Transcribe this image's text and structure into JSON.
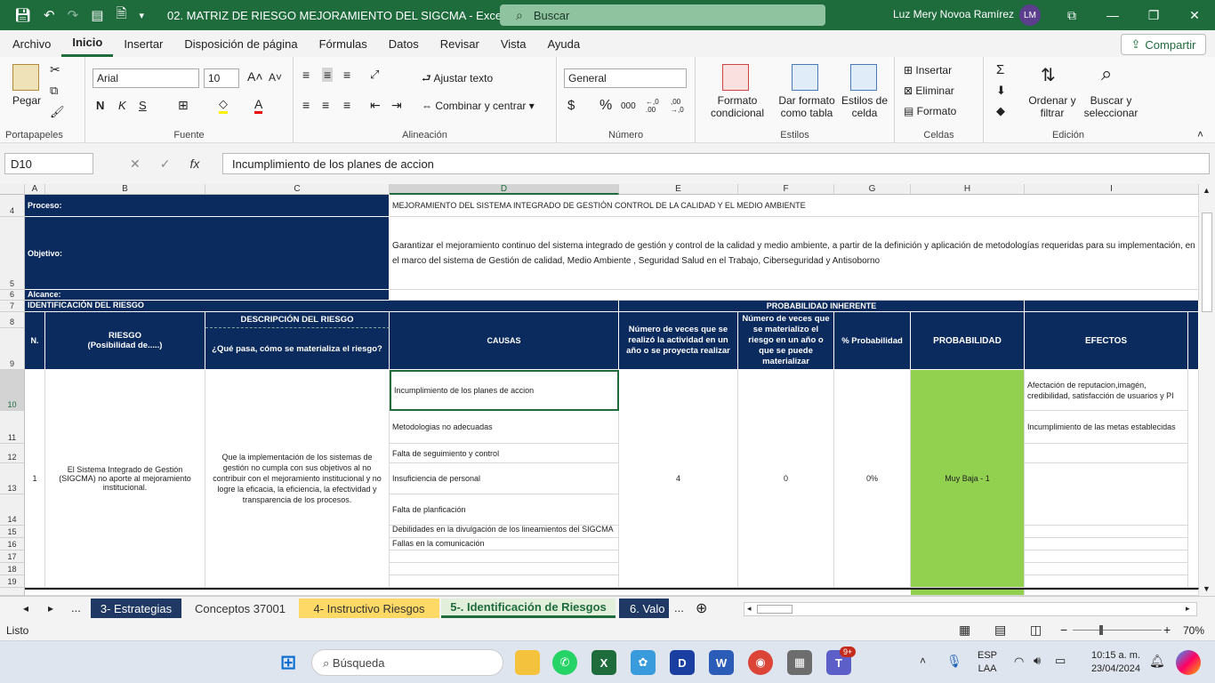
{
  "window": {
    "title": "02. MATRIZ DE RIESGO MEJORAMIENTO DEL SIGCMA  -  Excel",
    "search_placeholder": "Buscar",
    "user_name": "Luz Mery Novoa Ramírez",
    "user_initials": "LM"
  },
  "menu": {
    "items": [
      "Archivo",
      "Inicio",
      "Insertar",
      "Disposición de página",
      "Fórmulas",
      "Datos",
      "Revisar",
      "Vista",
      "Ayuda"
    ],
    "share_label": "Compartir"
  },
  "ribbon": {
    "clipboard": {
      "paste": "Pegar",
      "label": "Portapapeles"
    },
    "font": {
      "name": "Arial",
      "size": "10",
      "bold": "N",
      "italic": "K",
      "underline": "S",
      "label": "Fuente"
    },
    "alignment": {
      "wrap": "Ajustar texto",
      "merge": "Combinar y centrar",
      "label": "Alineación"
    },
    "number": {
      "format": "General",
      "currency": "$",
      "percent": "%",
      "thousands": "000",
      "inc_dec": "←,0 .00",
      "dec_dec": ",00 →,0",
      "label": "Número"
    },
    "styles": {
      "cond1": "Formato",
      "cond2": "condicional",
      "table1": "Dar formato",
      "table2": "como tabla",
      "cell1": "Estilos de",
      "cell2": "celda",
      "label": "Estilos"
    },
    "cells": {
      "insert": "Insertar",
      "delete": "Eliminar",
      "format": "Formato",
      "label": "Celdas"
    },
    "editing": {
      "sort1": "Ordenar y",
      "sort2": "filtrar",
      "find1": "Buscar y",
      "find2": "seleccionar",
      "label": "Edición"
    }
  },
  "formula_bar": {
    "name_box": "D10",
    "formula": "Incumplimiento de los  planes de accion"
  },
  "grid": {
    "columns": [
      "A",
      "B",
      "C",
      "D",
      "E",
      "F",
      "G",
      "H",
      "I"
    ],
    "rows": [
      "4",
      "5",
      "6",
      "7",
      "8",
      "9",
      "10",
      "11",
      "12",
      "13",
      "14",
      "15",
      "16",
      "17",
      "18",
      "19"
    ],
    "proceso_label": "Proceso:",
    "proceso_value": "MEJORAMIENTO DEL SISTEMA INTEGRADO DE GESTIÓN  CONTROL DE LA  CALIDAD  Y EL MEDIO AMBIENTE",
    "objetivo_label": "Objetivo:",
    "objetivo_value": "Garantizar el mejoramiento continuo del sistema integrado de gestión y control de la calidad y medio ambiente, a partir de la definición y aplicación de metodologías requeridas para su implementación, en el marco del sistema  de  Gestión  de calidad, Medio Ambiente , Seguridad Salud   en el Trabajo, Ciberseguridad y Antisoborno",
    "alcance_label": "Alcance:",
    "identificacion": "IDENTIFICACIÓN DEL RIESGO",
    "probabilidad_inherente": "PROBABILIDAD INHERENTE",
    "h_n": "N.",
    "h_riesgo": "RIESGO\n(Posibilidad de.....)",
    "h_desc": "DESCRIPCIÓN  DEL RIESGO",
    "h_desc_sub": "¿Qué pasa, cómo se materializa el riesgo?",
    "h_causas": "CAUSAS",
    "h_veces": "Número de veces que se realizó  la actividad en un año o se  proyecta realizar",
    "h_materializo": "Número de veces que se materializo el riesgo en un  año o que se puede materializar",
    "h_pct": "% Probabilidad",
    "h_prob": "PROBABILIDAD",
    "h_efectos": "EFECTOS",
    "n_value": "1",
    "riesgo_value": "El Sistema Integrado de Gestión (SIGCMA) no aporte  al mejoramiento institucional.",
    "desc_value": "Que  la implementación de los sistemas  de gestión no cumpla con sus objetivos al no contribuir con el mejoramiento institucional y no logre la eficacia, la eficiencia, la efectividad y transparencia  de los procesos.",
    "causas": [
      "Incumplimiento de los  planes de accion",
      "Metodologias no adecuadas",
      "Falta de seguimiento y control",
      "Insuficiencia de personal",
      "Falta de planficación",
      "Debilidades en la  divulgación de los lineamientos del SIGCMA",
      "Fallas en la comunicación"
    ],
    "veces_value": "4",
    "materializo_value": "0",
    "pct_value": "0%",
    "prob_value": "Muy Baja - 1",
    "efectos": [
      "Afectación de reputacion,imagén, credibilidad, satisfacción de usuarios y PI",
      "Incumplimiento de las metas establecidas"
    ],
    "colors": {
      "header": "#0b2a5e",
      "probabilidad": "#92d050"
    }
  },
  "sheet_tabs": {
    "more_left": "...",
    "tabs": [
      "3- Estrategias",
      "Conceptos 37001",
      "4- Instructivo Riesgos",
      "5-. Identificación de Riesgos",
      "6. Valo"
    ],
    "more_right": "...",
    "active_index": 3
  },
  "status": {
    "ready": "Listo",
    "zoom": "70%"
  },
  "taskbar": {
    "search": "Búsqueda",
    "lang1": "ESP",
    "lang2": "LAA",
    "time": "10:15 a. m.",
    "date": "23/04/2024",
    "badge": "9+"
  }
}
